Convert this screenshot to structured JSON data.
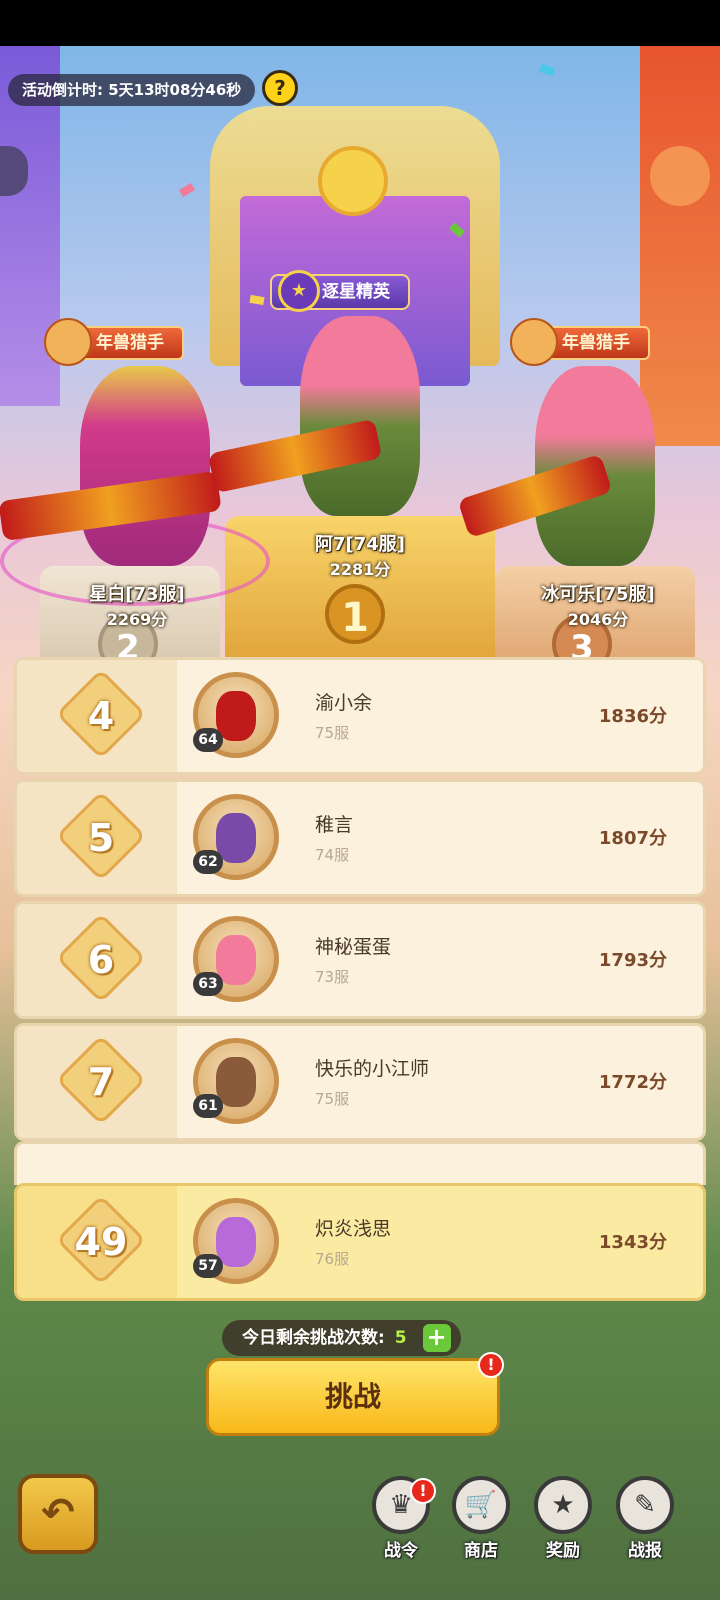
{
  "timer": {
    "text": "活动倒计时: 5天13时08分46秒"
  },
  "help": {
    "label": "?"
  },
  "podium": {
    "first": {
      "title": "逐星精英",
      "name": "阿7[74服]",
      "score": "2281分",
      "rank": "1"
    },
    "second": {
      "title": "年兽猎手",
      "name": "星白[73服]",
      "score": "2269分",
      "rank": "2"
    },
    "third": {
      "title": "年兽猎手",
      "name": "冰可乐[75服]",
      "score": "2046分",
      "rank": "3"
    }
  },
  "ranking": [
    {
      "rank": "4",
      "level": "64",
      "name": "渝小余",
      "server": "75服",
      "score": "1836分"
    },
    {
      "rank": "5",
      "level": "62",
      "name": "稚言",
      "server": "74服",
      "score": "1807分"
    },
    {
      "rank": "6",
      "level": "63",
      "name": "神秘蛋蛋",
      "server": "73服",
      "score": "1793分"
    },
    {
      "rank": "7",
      "level": "61",
      "name": "快乐的小江师",
      "server": "75服",
      "score": "1772分"
    }
  ],
  "my_rank": {
    "rank": "49",
    "level": "57",
    "name": "炽炎浅思",
    "server": "76服",
    "score": "1343分"
  },
  "remaining": {
    "label": "今日剩余挑战次数:",
    "count": "5",
    "plus": "+"
  },
  "challenge_button": {
    "label": "挑战",
    "alert": "!"
  },
  "bottom_nav": [
    {
      "label": "战令",
      "icon": "crown-icon",
      "glyph": "♛",
      "alert": "!"
    },
    {
      "label": "商店",
      "icon": "basket-icon",
      "glyph": "🛒"
    },
    {
      "label": "奖励",
      "icon": "star-shield-icon",
      "glyph": "★"
    },
    {
      "label": "战报",
      "icon": "notepad-icon",
      "glyph": "✎"
    }
  ],
  "back": {
    "glyph": "↶"
  },
  "colors": {
    "accent": "#f8b818",
    "row_bg": "#fbf1dd",
    "my_row_bg": "#fbeaa2",
    "score": "#7a4a2a"
  }
}
